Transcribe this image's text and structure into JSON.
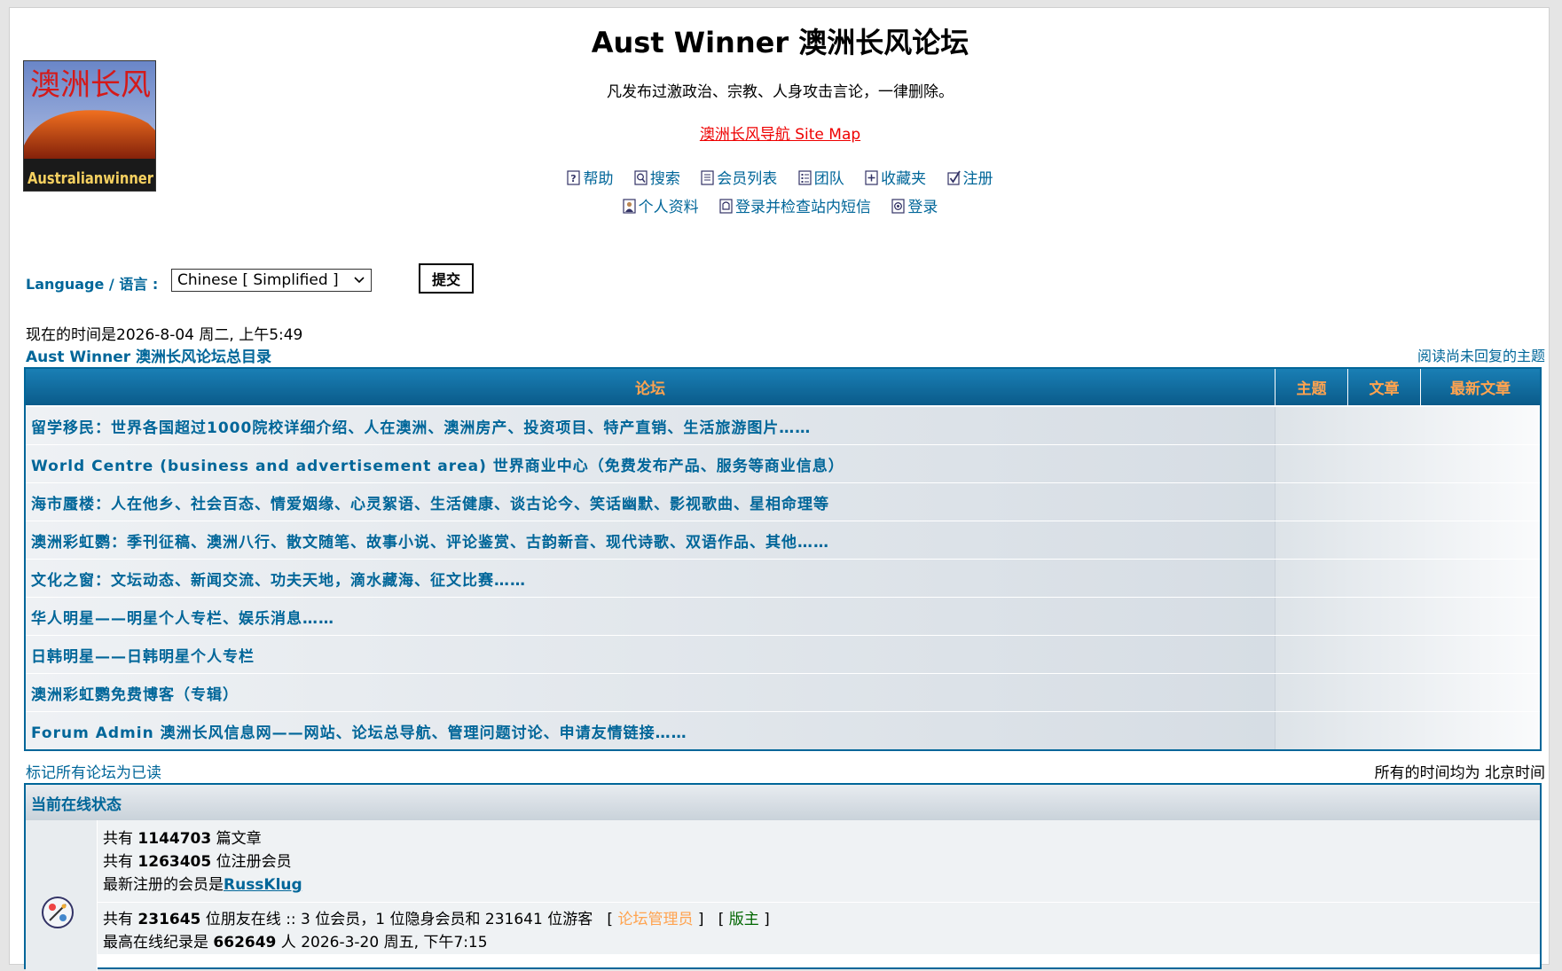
{
  "header": {
    "title": "Aust Winner 澳洲长风论坛",
    "description": "凡发布过激政治、宗教、人身攻击言论，一律删除。",
    "site_map_link": "澳洲长风导航 Site Map",
    "logo_text": "Australianwinner",
    "logo_chinese": "澳洲长风"
  },
  "nav": {
    "row1": [
      {
        "label": "帮助",
        "icon": "help-icon"
      },
      {
        "label": "搜索",
        "icon": "search-icon"
      },
      {
        "label": "会员列表",
        "icon": "memberlist-icon"
      },
      {
        "label": "团队",
        "icon": "groups-icon"
      },
      {
        "label": "收藏夹",
        "icon": "favorites-icon"
      },
      {
        "label": "注册",
        "icon": "register-icon"
      }
    ],
    "row2": [
      {
        "label": "个人资料",
        "icon": "profile-icon"
      },
      {
        "label": "登录并检查站内短信",
        "icon": "messages-icon"
      },
      {
        "label": "登录",
        "icon": "login-icon"
      }
    ]
  },
  "language": {
    "label": "Language / 语言 :",
    "selected": "Chinese [ Simplified ]",
    "submit_label": "提交"
  },
  "current_time": "现在的时间是2026-8-04 周二, 上午5:49",
  "index_link": "Aust Winner 澳洲长风论坛总目录",
  "unanswered_link": "阅读尚未回复的主题",
  "forum_table": {
    "headers": {
      "forum": "论坛",
      "topics": "主题",
      "posts": "文章",
      "last_post": "最新文章"
    },
    "rows": [
      "留学移民：世界各国超过1000院校详细介绍、人在澳洲、澳洲房产、投资项目、特产直销、生活旅游图片……",
      "World Centre (business and advertisement area) 世界商业中心（免费发布产品、服务等商业信息）",
      "海市蜃楼：人在他乡、社会百态、情爱姻缘、心灵絮语、生活健康、谈古论今、笑话幽默、影视歌曲、星相命理等",
      "澳洲彩虹鹦：季刊征稿、澳洲八行、散文随笔、故事小说、评论鉴赏、古韵新音、现代诗歌、双语作品、其他……",
      "文化之窗：文坛动态、新闻交流、功夫天地，滴水藏海、征文比赛……",
      "华人明星——明星个人专栏、娱乐消息……",
      "日韩明星——日韩明星个人专栏",
      "澳洲彩虹鹦免费博客（专辑）",
      "Forum Admin 澳洲长风信息网——网站、论坛总导航、管理问题讨论、申请友情链接……"
    ]
  },
  "mark_read": "标记所有论坛为已读",
  "timezone_note": "所有的时间均为 北京时间",
  "online": {
    "heading": "当前在线状态",
    "posts_prefix": "共有",
    "posts_count": "1144703",
    "posts_suffix": "篇文章",
    "members_prefix": "共有",
    "members_count": "1263405",
    "members_suffix": "位注册会员",
    "newest_prefix": "最新注册的会员是",
    "newest_member": "RussKlug",
    "online_prefix": "共有",
    "online_count": "231645",
    "online_suffix": "位朋友在线 :: 3 位会员，1 位隐身会员和 231641 位游客",
    "admin_label": "论坛管理员",
    "mod_label": "版主",
    "record_prefix": "最高在线纪录是",
    "record_count": "662649",
    "record_suffix": "人 2026-3-20 周五, 下午7:15"
  },
  "colors": {
    "link": "#006699",
    "header_orange": "#ffa34f",
    "site_map_red": "#ee0000"
  }
}
